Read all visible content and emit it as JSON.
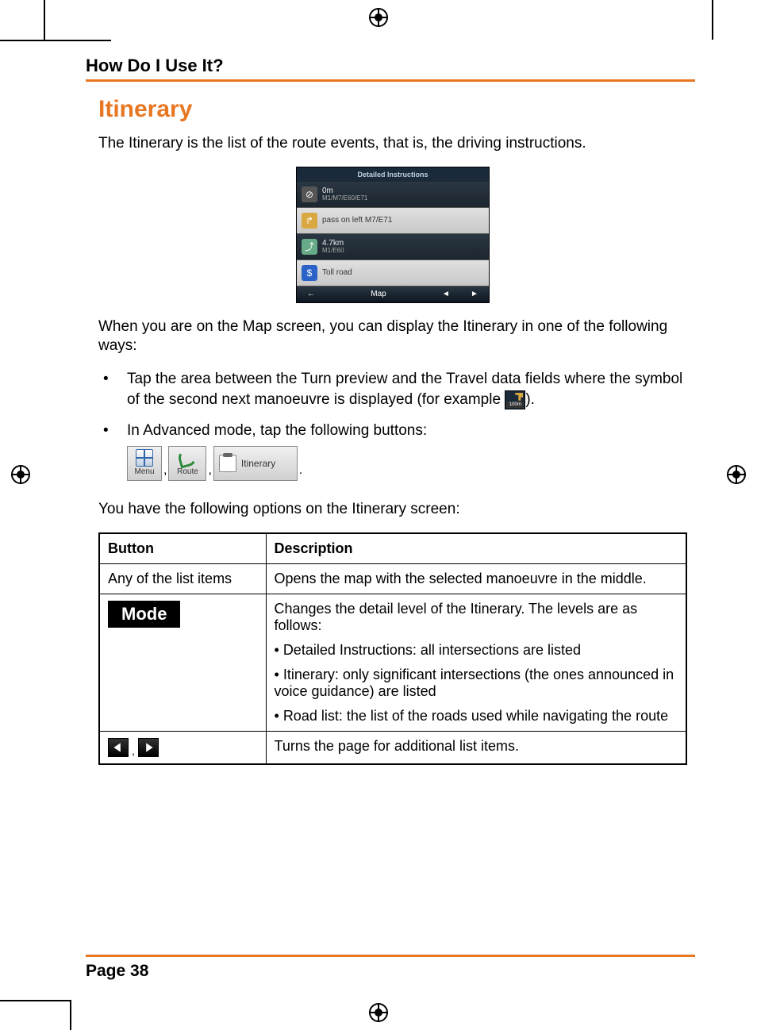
{
  "header": "How Do I Use It?",
  "title": "Itinerary",
  "intro": "The Itinerary is the list of the route events, that is, the driving instructions.",
  "screenshot": {
    "title": "Detailed Instructions",
    "rows": [
      {
        "main": "0m",
        "sub": "M1/M7/E60/E71",
        "dark": true
      },
      {
        "main": "pass on left M7/E71",
        "sub": "",
        "dark": false
      },
      {
        "main": "4.7km",
        "sub": "M1/E60",
        "dark": true
      },
      {
        "main": "Toll road",
        "sub": "",
        "dark": false
      }
    ],
    "footer_label": "Map"
  },
  "para2": "When you are on the Map screen, you can display the Itinerary in one of the following ways:",
  "bullets": [
    {
      "pre": "Tap the area between the Turn preview and the Travel data fields where the symbol of the second next manoeuvre is displayed (for example ",
      "icon_dist": "100m",
      "post": ")."
    },
    {
      "text": "In Advanced mode, tap the following buttons:",
      "buttons": {
        "menu": "Menu",
        "route": "Route",
        "itinerary": "Itinerary"
      }
    }
  ],
  "options_intro": "You have the following options on the Itinerary screen:",
  "table": {
    "head": {
      "c1": "Button",
      "c2": "Description"
    },
    "rows": [
      {
        "button_text": "Any of the list items",
        "desc": "Opens the map with the selected manoeuvre in the middle."
      },
      {
        "button_label": "Mode",
        "desc": "Changes the detail level of the Itinerary. The levels are as follows:",
        "subs": [
          "Detailed Instructions: all intersections are listed",
          "Itinerary: only significant intersections (the ones announced in voice guidance) are listed",
          "Road list: the list of the roads used while navigating the route"
        ]
      },
      {
        "pager": true,
        "desc": "Turns the page for additional list items."
      }
    ]
  },
  "page_number": "Page 38"
}
